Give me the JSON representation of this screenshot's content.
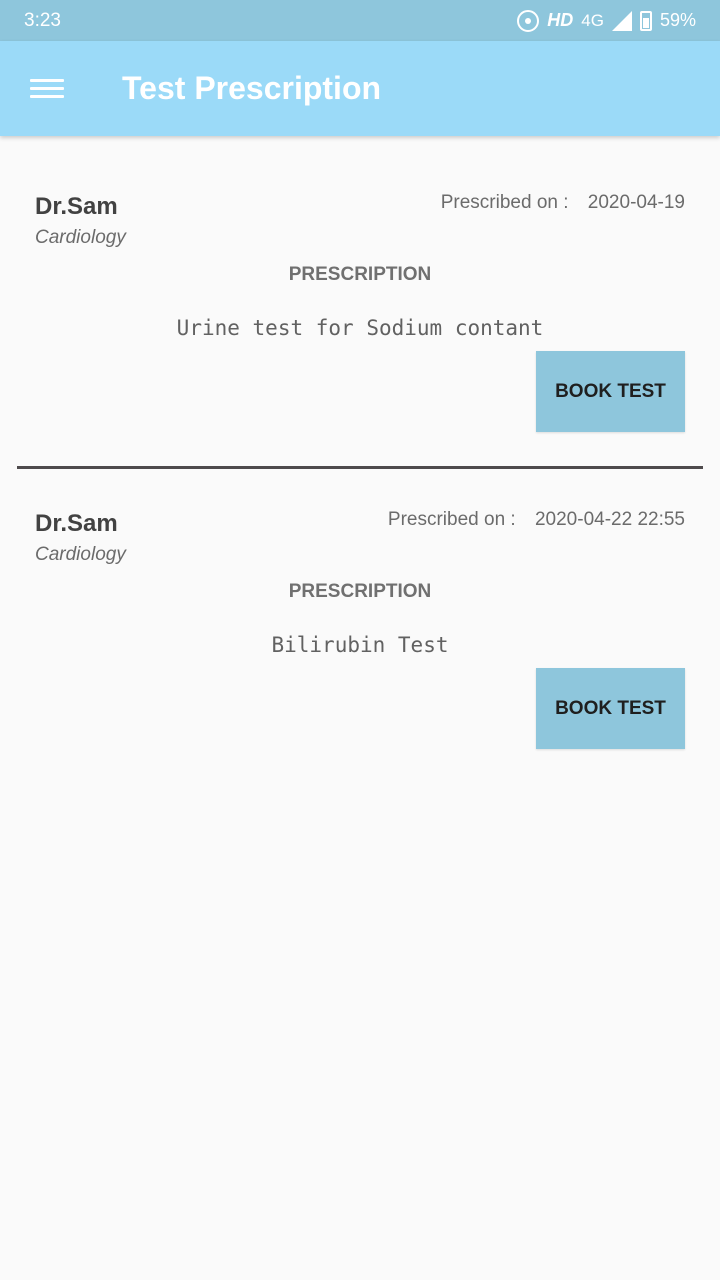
{
  "status_bar": {
    "time": "3:23",
    "hd": "HD",
    "network": "4G",
    "battery": "59%",
    "icons": [
      "hotspot-icon",
      "signal-icon",
      "battery-icon"
    ]
  },
  "app_bar": {
    "title": "Test Prescription",
    "menu_icon": "hamburger-menu-icon",
    "background": "#9bdaf8"
  },
  "prescriptions": [
    {
      "doctor": "Dr.Sam",
      "department": "Cardiology",
      "prescribed_label": "Prescribed on :",
      "prescribed_date": "2020-04-19",
      "section_label": "PRESCRIPTION",
      "test": "Urine test for Sodium contant",
      "button_label": "BOOK TEST"
    },
    {
      "doctor": "Dr.Sam",
      "department": "Cardiology",
      "prescribed_label": "Prescribed on :",
      "prescribed_date": "2020-04-22 22:55",
      "section_label": "PRESCRIPTION",
      "test": "Bilirubin Test",
      "button_label": "BOOK TEST"
    }
  ],
  "colors": {
    "status_bar": "#8ec6dc",
    "button": "#8ec6dc",
    "divider": "#4e4a4c"
  }
}
